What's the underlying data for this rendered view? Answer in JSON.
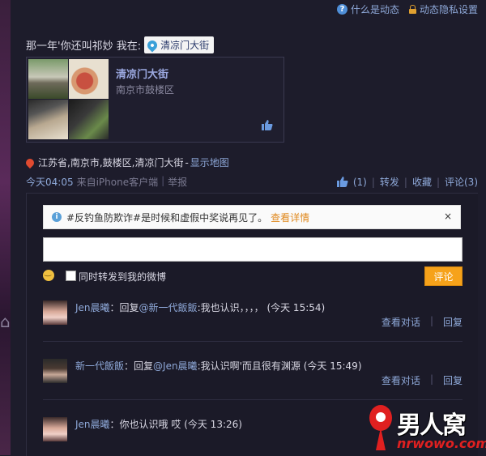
{
  "top_links": {
    "what_is": "什么是动态",
    "privacy": "动态隐私设置"
  },
  "post": {
    "text": "那一年'你还叫祁妙 我在:",
    "location_chip": "清凉门大街",
    "card": {
      "title": "清凉门大街",
      "subtitle": "南京市鼓楼区"
    },
    "address": "江苏省,南京市,鼓楼区,清凉门大街",
    "address_sep": " - ",
    "show_map": "显示地图",
    "time": "今天04:05",
    "source": "来自iPhone客户端",
    "report": "举报"
  },
  "actions": {
    "like_count": "(1)",
    "repost": "转发",
    "favorite": "收藏",
    "comment": "评论(3)"
  },
  "notice": {
    "text": "#反钓鱼防欺诈#是时候和虚假中奖说再见了。",
    "detail": "查看详情",
    "close": "×"
  },
  "reply_box": {
    "input_value": "",
    "also_repost_label": "同时转发到我的微博",
    "submit": "评论"
  },
  "comments": [
    {
      "user": "Jen晨曦",
      "text": "：回复",
      "mention": "@新一代飯飯",
      "body": ":我也认识，，，，",
      "time": "(今天 15:54)",
      "view_dialog": "查看对话",
      "reply": "回复"
    },
    {
      "user": "新一代飯飯",
      "text": "：回复",
      "mention": "@Jen晨曦",
      "body": ":我认识啊'而且很有渊源",
      "time": "(今天 15:49)",
      "view_dialog": "查看对话",
      "reply": "回复"
    },
    {
      "user": "Jen晨曦",
      "text": "：你也认识哦 哎",
      "mention": "",
      "body": "",
      "time": "(今天 13:26)"
    }
  ],
  "watermark": {
    "title": "男人窝",
    "url": "nrwowo.com"
  },
  "colors": {
    "background": "#1d1c2b",
    "link": "#8ea8d8",
    "submit": "#f6a21a",
    "notice_link": "#e08a20"
  }
}
